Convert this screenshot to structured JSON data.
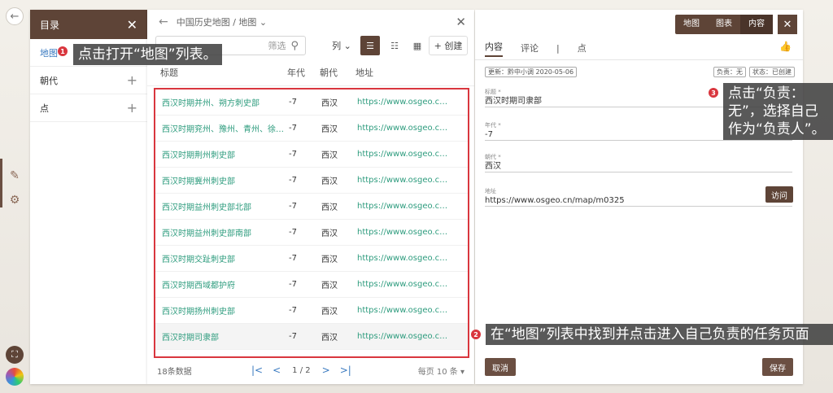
{
  "rail": {
    "back_icon": "←",
    "edit_icon": "✎",
    "settings_icon": "⚙",
    "fullscreen_icon": "⛶"
  },
  "directory": {
    "title": "目录",
    "close": "✕",
    "items": [
      {
        "label": "地图",
        "active": true
      },
      {
        "label": "朝代",
        "plus": "+"
      },
      {
        "label": "点",
        "plus": "+"
      }
    ]
  },
  "list": {
    "back": "←",
    "breadcrumb": "中国历史地图 / 地图 ⌄",
    "close": "✕",
    "search_placeholder": "筛选",
    "search_icon": "⚲",
    "columns_btn": "列 ⌄",
    "create_btn": "+ 创建",
    "headers": [
      "标题",
      "年代",
      "朝代",
      "地址"
    ],
    "rows": [
      {
        "title": "西汉时期并州、朔方刺史部",
        "year": "-7",
        "dynasty": "西汉",
        "url": "https://www.osgeo.cn/map/..."
      },
      {
        "title": "西汉时期兖州、豫州、青州、徐州...",
        "year": "-7",
        "dynasty": "西汉",
        "url": "https://www.osgeo.cn/map/..."
      },
      {
        "title": "西汉时期荆州刺史部",
        "year": "-7",
        "dynasty": "西汉",
        "url": "https://www.osgeo.cn/map/..."
      },
      {
        "title": "西汉时期冀州刺史部",
        "year": "-7",
        "dynasty": "西汉",
        "url": "https://www.osgeo.cn/map/..."
      },
      {
        "title": "西汉时期益州刺史部北部",
        "year": "-7",
        "dynasty": "西汉",
        "url": "https://www.osgeo.cn/map/..."
      },
      {
        "title": "西汉时期益州刺史部南部",
        "year": "-7",
        "dynasty": "西汉",
        "url": "https://www.osgeo.cn/map/..."
      },
      {
        "title": "西汉时期交趾刺史部",
        "year": "-7",
        "dynasty": "西汉",
        "url": "https://www.osgeo.cn/map/..."
      },
      {
        "title": "西汉时期西域都护府",
        "year": "-7",
        "dynasty": "西汉",
        "url": "https://www.osgeo.cn/map/..."
      },
      {
        "title": "西汉时期扬州刺史部",
        "year": "-7",
        "dynasty": "西汉",
        "url": "https://www.osgeo.cn/map/..."
      },
      {
        "title": "西汉时期司隶部",
        "year": "-7",
        "dynasty": "西汉",
        "url": "https://www.osgeo.cn/map/..."
      }
    ],
    "pager": {
      "count": "18条数据",
      "first": "|<",
      "prev": "<",
      "page": "1 / 2",
      "next": ">",
      "last": ">|",
      "per_page": "每页 10 条 ▾"
    }
  },
  "detail": {
    "view_tabs": [
      "地图",
      "图表",
      "内容"
    ],
    "close": "✕",
    "tabs": [
      "内容",
      "评论",
      "|",
      "点"
    ],
    "thumb_icon": "👍",
    "meta_updated": "更新：黔中小调 2020-05-06",
    "meta_owner": "负责：无",
    "meta_status": "状态：已创建",
    "fields": [
      {
        "label": "标题 *",
        "value": "西汉时期司隶部"
      },
      {
        "label": "年代 *",
        "value": "-7"
      },
      {
        "label": "朝代 *",
        "value": "西汉"
      },
      {
        "label": "地址",
        "value": "https://www.osgeo.cn/map/m0325"
      }
    ],
    "visit": "访问",
    "save": "保存",
    "cancel": "取消"
  },
  "callouts": {
    "c1": "点击打开“地图”列表。",
    "c2": "在“地图”列表中找到并点击进入自己负责的任务页面",
    "c3": "点击“负责：无”，选择自己作为“负责人”。",
    "b1": "1",
    "b2": "2",
    "b3": "3"
  }
}
